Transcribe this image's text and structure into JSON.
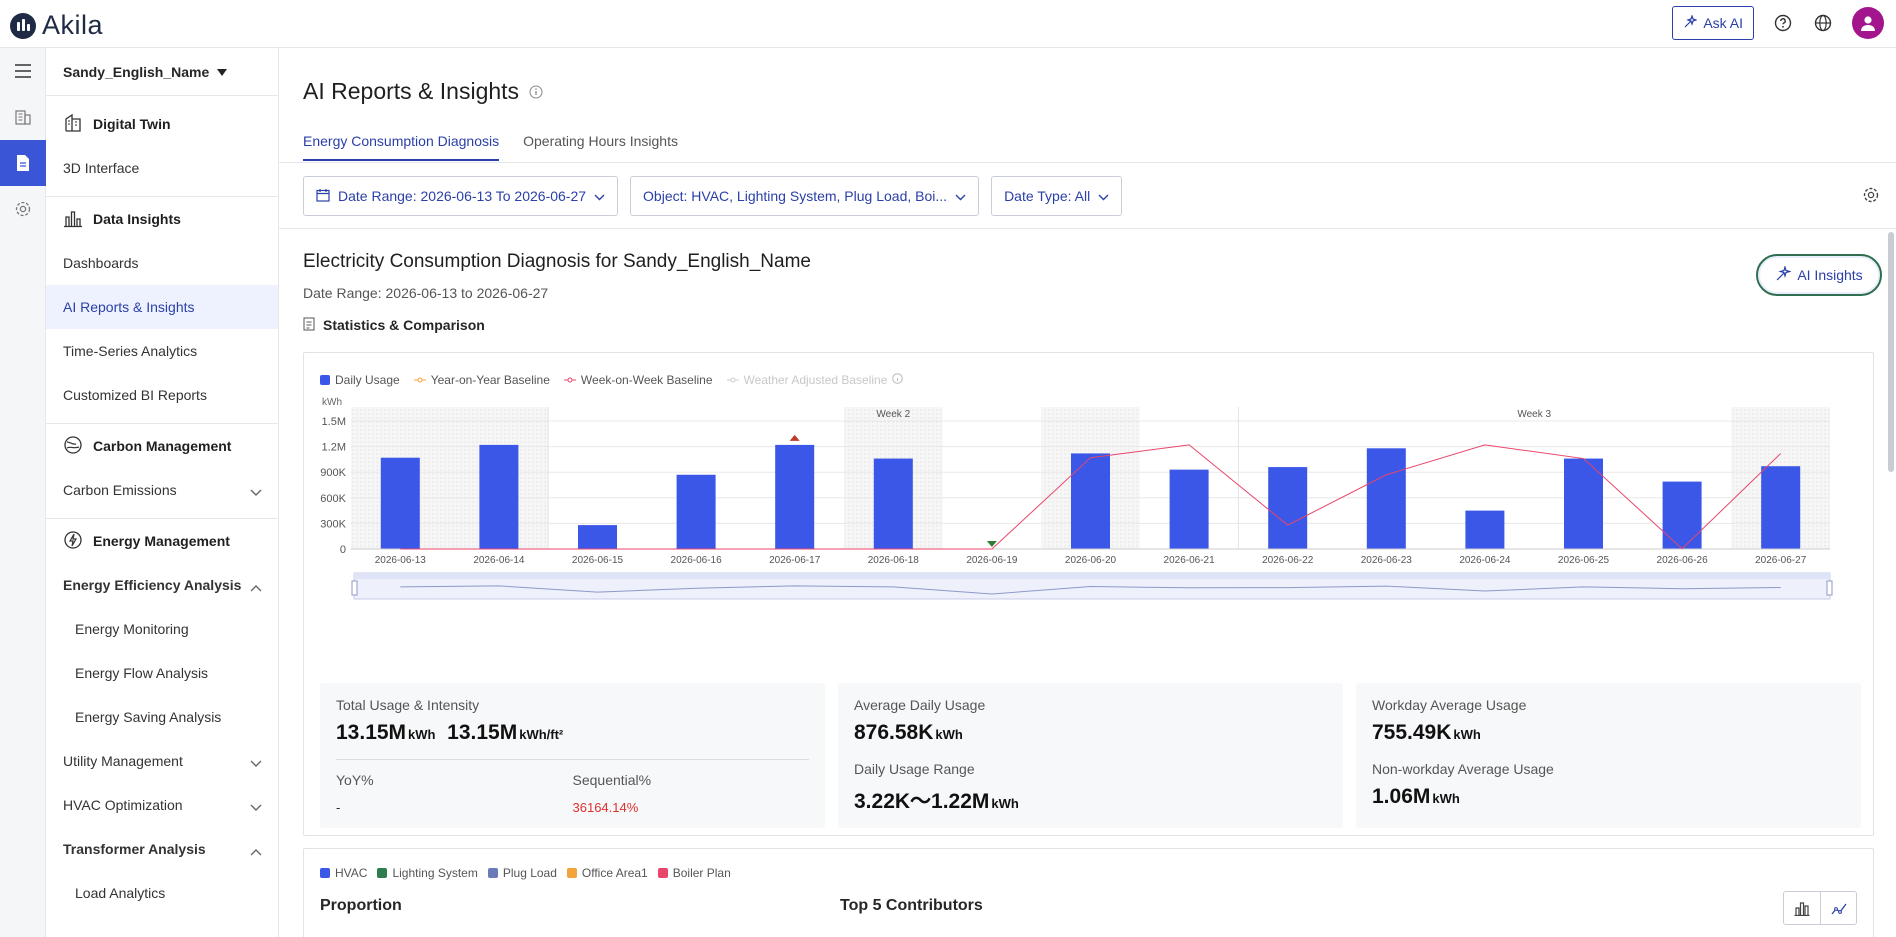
{
  "app": {
    "brand": "Akila",
    "ask_ai": "Ask AI"
  },
  "rail": {
    "icons": [
      "building-icon",
      "report-icon",
      "settings-icon"
    ]
  },
  "sidebar": {
    "project": "Sandy_English_Name",
    "groups": [
      {
        "title": "Digital Twin",
        "items": [
          "3D Interface"
        ]
      },
      {
        "title": "Data Insights",
        "items": [
          "Dashboards",
          "AI Reports & Insights",
          "Time-Series Analytics",
          "Customized BI Reports"
        ]
      },
      {
        "title": "Carbon Management",
        "items": [
          "Carbon Emissions"
        ]
      },
      {
        "title": "Energy Management",
        "items": [
          "Energy Efficiency Analysis",
          "Energy Monitoring",
          "Energy Flow Analysis",
          "Energy Saving Analysis",
          "Utility Management",
          "HVAC Optimization",
          "Transformer Analysis",
          "Load Analytics"
        ]
      }
    ]
  },
  "page": {
    "title": "AI Reports & Insights",
    "tabs": [
      "Energy Consumption Diagnosis",
      "Operating Hours Insights"
    ],
    "filters": {
      "date_range": "Date Range: 2026-06-13 To 2026-06-27",
      "object": "Object: HVAC, Lighting System, Plug Load, Boi...",
      "date_type": "Date Type: All"
    },
    "section_title": "Electricity Consumption Diagnosis for Sandy_English_Name",
    "date_range_text": "Date Range: 2026-06-13 to 2026-06-27",
    "stat_heading": "Statistics & Comparison",
    "ai_insights": "AI Insights"
  },
  "legend": {
    "daily": "Daily Usage",
    "yoy": "Year-on-Year Baseline",
    "wow": "Week-on-Week Baseline",
    "weather": "Weather Adjusted Baseline"
  },
  "colors": {
    "bar": "#3a57e8",
    "wow": "#e8466b",
    "yoy": "#f2a33a",
    "accent": "#2a3fa8",
    "up": "#c0392b",
    "down": "#2e7d32"
  },
  "chart_data": {
    "type": "bar",
    "unit": "kWh",
    "categories": [
      "2026-06-13",
      "2026-06-14",
      "2026-06-15",
      "2026-06-16",
      "2026-06-17",
      "2026-06-18",
      "2026-06-19",
      "2026-06-20",
      "2026-06-21",
      "2026-06-22",
      "2026-06-23",
      "2026-06-24",
      "2026-06-25",
      "2026-06-26",
      "2026-06-27"
    ],
    "series": [
      {
        "name": "Daily Usage",
        "values": [
          1070000,
          1220000,
          280000,
          870000,
          1220000,
          1060000,
          3220,
          1120000,
          930000,
          960000,
          1180000,
          450000,
          1060000,
          790000,
          970000
        ]
      },
      {
        "name": "Week-on-Week Baseline",
        "values": [
          0,
          0,
          0,
          0,
          0,
          0,
          0,
          1070000,
          1220000,
          280000,
          870000,
          1220000,
          1060000,
          3220,
          1120000
        ]
      }
    ],
    "yticks": [
      "0",
      "300K",
      "600K",
      "900K",
      "1.2M",
      "1.5M"
    ],
    "ylim": [
      0,
      1500000
    ],
    "week_labels": [
      "Week 2",
      "Week 3"
    ],
    "markers": {
      "up": "2026-06-17",
      "down": "2026-06-19"
    }
  },
  "stats": {
    "total": {
      "label": "Total Usage & Intensity",
      "value1": "13.15M",
      "unit1": "kWh",
      "value2": "13.15M",
      "unit2": "kWh/ft²",
      "yoy_label": "YoY%",
      "yoy_value": "-",
      "seq_label": "Sequential%",
      "seq_value": "36164.14%"
    },
    "avg": {
      "label": "Average Daily Usage",
      "value": "876.58K",
      "unit": "kWh",
      "range_label": "Daily Usage Range",
      "range_value": "3.22K～1.22M",
      "range_unit": "kWh"
    },
    "workday": {
      "label": "Workday Average Usage",
      "value": "755.49K",
      "unit": "kWh",
      "non_label": "Non-workday Average Usage",
      "non_value": "1.06M",
      "non_unit": "kWh"
    }
  },
  "breakdown": {
    "legend": [
      "HVAC",
      "Lighting System",
      "Plug Load",
      "Office Area1",
      "Boiler Plan"
    ],
    "legend_colors": [
      "#3a57e8",
      "#2e7d4f",
      "#6b7bb8",
      "#f2a33a",
      "#e8466b"
    ],
    "proportion": "Proportion",
    "top5": "Top 5 Contributors"
  }
}
